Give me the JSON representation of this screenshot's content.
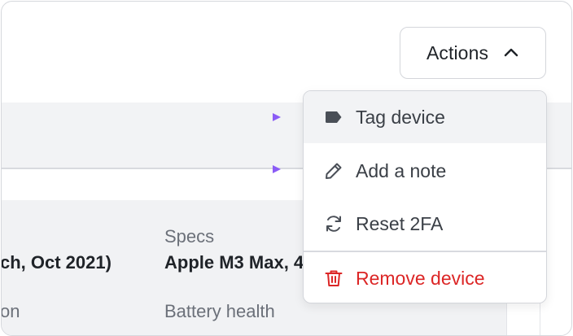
{
  "actions_button": {
    "label": "Actions",
    "chevron": "chevron-up-icon"
  },
  "menu": {
    "items": [
      {
        "label": "Tag device",
        "icon": "tag-icon"
      },
      {
        "label": "Add a note",
        "icon": "pencil-icon"
      },
      {
        "label": "Reset 2FA",
        "icon": "refresh-icon"
      },
      {
        "label": "Remove device",
        "icon": "trash-icon",
        "color": "#dc2626"
      }
    ]
  },
  "details": {
    "model_value": "ch, Oct 2021)",
    "model_next_label": "on",
    "specs_label": "Specs",
    "specs_value": "Apple M3 Max, 4",
    "battery_label": "Battery health"
  },
  "colors": {
    "danger": "#dc2626",
    "arrow_start": "#38bdf8",
    "arrow_mid": "#e11d48",
    "arrow_end": "#8b5cf6"
  }
}
